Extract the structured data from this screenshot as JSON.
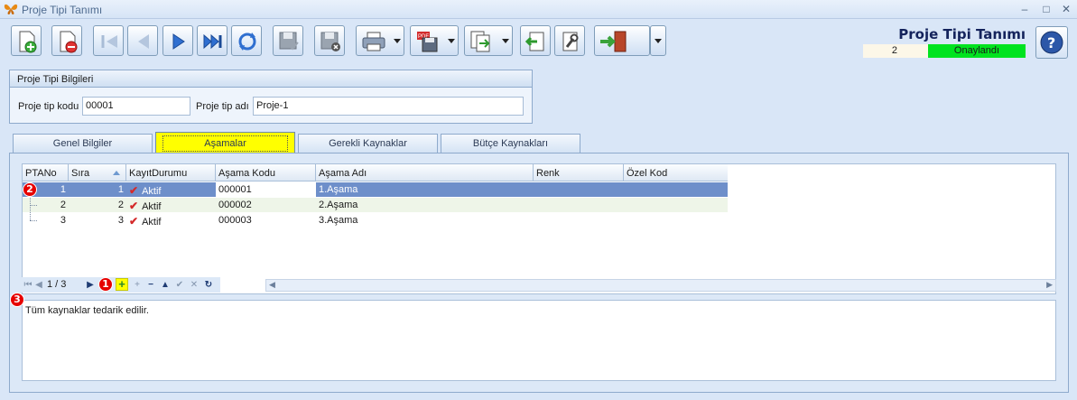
{
  "window": {
    "title": "Proje Tipi Tanımı",
    "minimize": "–",
    "maximize": "□",
    "close": "✕"
  },
  "toolbar": {
    "buttons": [
      {
        "name": "new-record",
        "icon": "new-document-icon"
      },
      {
        "name": "delete-record",
        "icon": "delete-document-icon"
      },
      {
        "name": "first-record",
        "icon": "first-icon"
      },
      {
        "name": "prev-record",
        "icon": "prev-icon"
      },
      {
        "name": "next-record",
        "icon": "next-icon"
      },
      {
        "name": "last-record",
        "icon": "last-icon"
      },
      {
        "name": "refresh",
        "icon": "refresh-icon"
      },
      {
        "name": "save-approve",
        "icon": "save-check-icon"
      },
      {
        "name": "save-cancel",
        "icon": "save-cancel-icon"
      },
      {
        "name": "print",
        "icon": "printer-icon"
      },
      {
        "name": "pdf-export",
        "icon": "pdf-icon"
      },
      {
        "name": "export",
        "icon": "export-icon"
      },
      {
        "name": "import",
        "icon": "import-icon"
      },
      {
        "name": "tools",
        "icon": "wrench-icon"
      },
      {
        "name": "exit",
        "icon": "exit-door-icon"
      }
    ]
  },
  "header": {
    "title": "Proje Tipi Tanımı",
    "count": "2",
    "status": "Onaylandı",
    "status_color": "#00e31f"
  },
  "info_group": {
    "title": "Proje Tipi Bilgileri",
    "code_label": "Proje tip kodu",
    "code_value": "00001",
    "name_label": "Proje tip adı",
    "name_value": "Proje-1"
  },
  "tabs": [
    {
      "label": "Genel Bilgiler"
    },
    {
      "label": "Aşamalar"
    },
    {
      "label": "Gerekli Kaynaklar"
    },
    {
      "label": "Bütçe Kaynakları"
    }
  ],
  "active_tab": "Aşamalar",
  "grid": {
    "columns": [
      "PTANo",
      "Sıra",
      "KayıtDurumu",
      "Aşama Kodu",
      "Aşama Adı",
      "Renk",
      "Özel Kod"
    ],
    "rows": [
      {
        "ptano": "1",
        "sira": "1",
        "durum": "Aktif",
        "kod": "000001",
        "ad": "1.Aşama",
        "renk": "",
        "ozel": ""
      },
      {
        "ptano": "2",
        "sira": "2",
        "durum": "Aktif",
        "kod": "000002",
        "ad": "2.Aşama",
        "renk": "",
        "ozel": ""
      },
      {
        "ptano": "3",
        "sira": "3",
        "durum": "Aktif",
        "kod": "000003",
        "ad": "3.Aşama",
        "renk": "",
        "ozel": ""
      }
    ]
  },
  "navigator": {
    "position": "1 / 3",
    "first": "⏮",
    "prev": "◀",
    "next": "▶",
    "add": "+",
    "add_child": "+",
    "remove": "−",
    "up": "▲",
    "confirm": "✔",
    "cancel": "✕",
    "refresh": "↻"
  },
  "memo": {
    "text": "Tüm kaynaklar tedarik edilir."
  },
  "markers": [
    "1",
    "2",
    "3"
  ]
}
